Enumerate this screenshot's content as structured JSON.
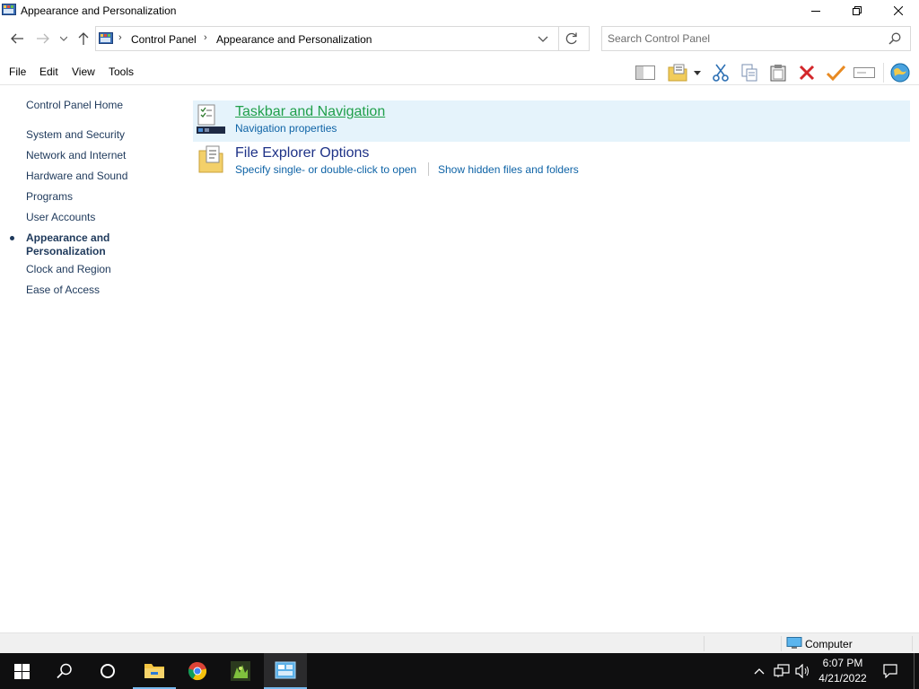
{
  "window": {
    "title": "Appearance and Personalization",
    "icons": {
      "app": "control-panel-icon",
      "minimize": "minimize-icon",
      "maximize": "restore-icon",
      "close": "close-icon"
    }
  },
  "nav": {
    "breadcrumbs": [
      {
        "label": "Control Panel"
      },
      {
        "label": "Appearance and Personalization"
      }
    ],
    "search_placeholder": "Search Control Panel"
  },
  "menu": {
    "items": [
      "File",
      "Edit",
      "View",
      "Tools"
    ]
  },
  "sidebar": {
    "home": "Control Panel Home",
    "items": [
      {
        "label": "System and Security"
      },
      {
        "label": "Network and Internet"
      },
      {
        "label": "Hardware and Sound"
      },
      {
        "label": "Programs"
      },
      {
        "label": "User Accounts"
      },
      {
        "label": "Appearance and Personalization",
        "active": true
      },
      {
        "label": "Clock and Region"
      },
      {
        "label": "Ease of Access"
      }
    ]
  },
  "categories": [
    {
      "title": "Taskbar and Navigation",
      "icon": "taskbar-icon",
      "links": [
        "Navigation properties"
      ]
    },
    {
      "title": "File Explorer Options",
      "icon": "folder-options-icon",
      "links": [
        "Specify single- or double-click to open",
        "Show hidden files and folders"
      ]
    }
  ],
  "statusbar": {
    "location": "Computer"
  },
  "taskbar": {
    "time": "6:07 PM",
    "date": "4/21/2022"
  },
  "colors": {
    "link": "#0e63a6",
    "title": "#1e3287",
    "hover_title": "#21a04b",
    "highlight": "#e5f3fb",
    "taskbar": "#0f0f10"
  }
}
